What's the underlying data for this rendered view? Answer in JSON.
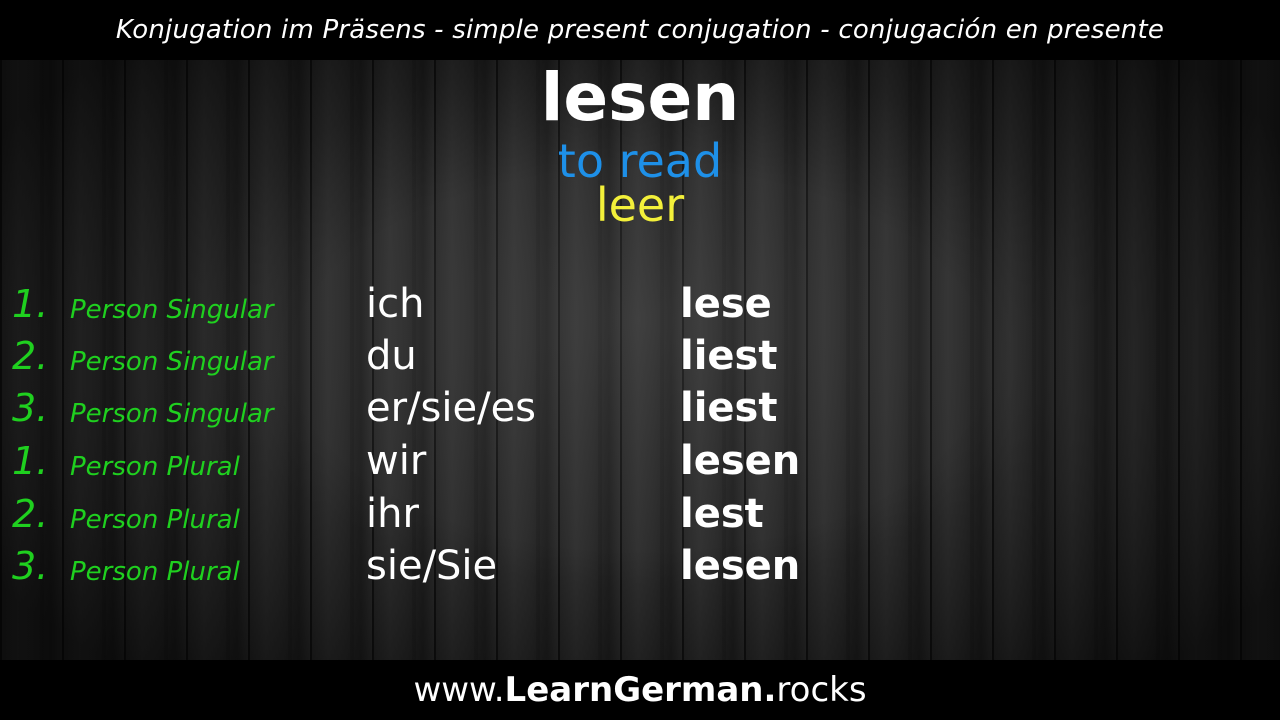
{
  "header": {
    "title": "Konjugation im Präsens - simple present conjugation - conjugación en presente"
  },
  "verb": {
    "infinitive": "lesen",
    "translation_en": "to read",
    "translation_es": "leer"
  },
  "conjugation": [
    {
      "number": "1.",
      "person": "Person Singular",
      "pronoun": "ich",
      "form": "lese"
    },
    {
      "number": "2.",
      "person": "Person Singular",
      "pronoun": "du",
      "form": "liest"
    },
    {
      "number": "3.",
      "person": "Person Singular",
      "pronoun": "er/sie/es",
      "form": "liest"
    },
    {
      "number": "1.",
      "person": "Person Plural",
      "pronoun": "wir",
      "form": "lesen"
    },
    {
      "number": "2.",
      "person": "Person Plural",
      "pronoun": "ihr",
      "form": "lest"
    },
    {
      "number": "3.",
      "person": "Person Plural",
      "pronoun": "sie/Sie",
      "form": "lesen"
    }
  ],
  "footer": {
    "url_prefix": "www.",
    "url_brand": "LearnGerman.",
    "url_suffix": "rocks"
  },
  "colors": {
    "person_label": "#1fd01f",
    "translation_en": "#1e90e8",
    "translation_es": "#f3f03a",
    "text": "#ffffff",
    "bars": "#000000"
  }
}
